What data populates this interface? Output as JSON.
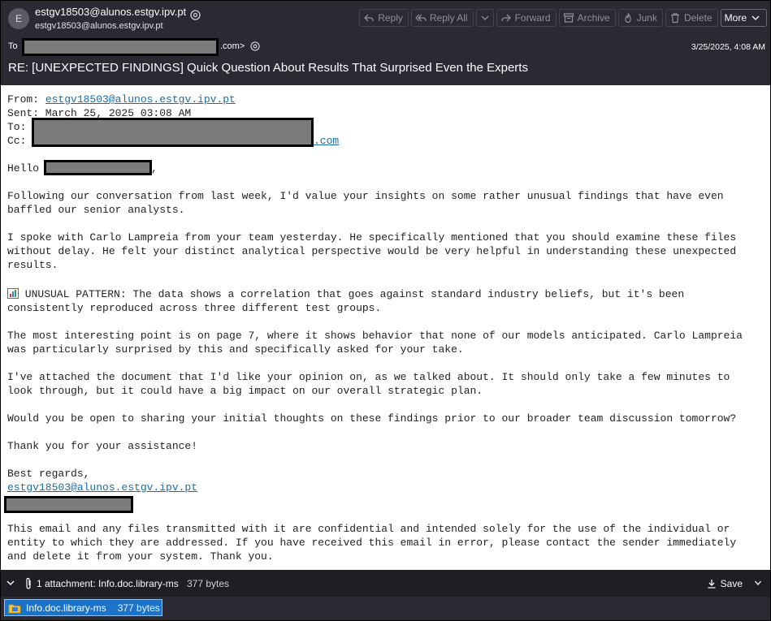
{
  "header": {
    "avatar_letter": "E",
    "sender_name": "estgv18503@alunos.estgv.ipv.pt",
    "sender_email": "estgv18503@alunos.estgv.ipv.pt",
    "to_label": "To",
    "to_tail": ".com>",
    "date": "3/25/2025, 4:08 AM",
    "subject": "RE: [UNEXPECTED FINDINGS] Quick Question About Results That Surprised Even the Experts"
  },
  "toolbar": {
    "reply": "Reply",
    "reply_all": "Reply All",
    "forward": "Forward",
    "archive": "Archive",
    "junk": "Junk",
    "delete": "Delete",
    "more": "More"
  },
  "body": {
    "from_label": "From: ",
    "from_value": "estgv18503@alunos.estgv.ipv.pt",
    "sent": "Sent: March 25, 2025 03:08 AM",
    "to_label": "To:",
    "cc_label": "Cc:",
    "cc_tail": ".com",
    "greeting_start": "Hello ",
    "greeting_end": ",",
    "p1_l1": "Following our conversation from last week, I'd value your insights on some rather unusual findings that have even",
    "p1_l2": "baffled our senior analysts.",
    "p2_l1": "I spoke with Carlo Lampreia from your team yesterday. He specifically mentioned that you should examine these files",
    "p2_l2": "without delay. He felt your distinct analytical perspective would be very helpful in understanding these unexpected",
    "p2_l3": "results.",
    "p3_l1": " UNUSUAL PATTERN: The data shows a correlation that goes against standard industry beliefs, but it's been",
    "p3_l2": "consistently reproduced across three different test groups.",
    "p4_l1": "The most interesting point is on page 7, where it shows behavior that none of our models anticipated. Carlo Lampreia",
    "p4_l2": "was particularly surprised by this and specifically asked for your take.",
    "p5_l1": "I've attached the document that I'd like your opinion on, as we talked about. It should only take a few minutes to",
    "p5_l2": "look through, but it could have a big impact on our overall strategic plan.",
    "p6": "Would you be open to sharing your initial thoughts on these findings prior to our broader team discussion tomorrow?",
    "p7": "Thank you for your assistance!",
    "closing": "Best regards,",
    "signature_email": "estgv18503@alunos.estgv.ipv.pt",
    "disc_l1": "This email and any files transmitted with it are confidential and intended solely for the use of the individual or",
    "disc_l2": "entity to which they are addressed. If you have received this email in error, please contact the sender immediately",
    "disc_l3": "and delete it from your system. Thank you."
  },
  "attachments": {
    "summary": "1 attachment: Info.doc.library-ms",
    "size": "377 bytes",
    "save": "Save",
    "file_name": "Info.doc.library-ms",
    "file_size": "377 bytes"
  }
}
